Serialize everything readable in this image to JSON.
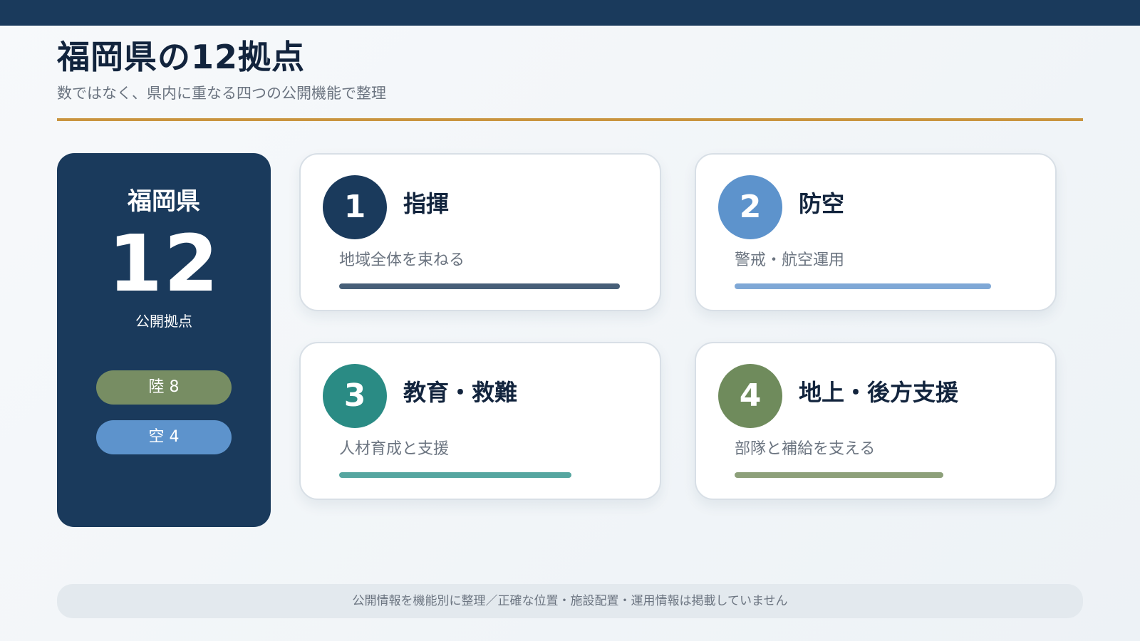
{
  "header": {
    "title": "福岡県の12拠点",
    "subtitle": "数ではなく、県内に重なる四つの公開機能で整理"
  },
  "summary": {
    "prefecture": "福岡県",
    "count": "12",
    "count_label": "公開拠点",
    "land_label": "陸 8",
    "air_label": "空 4"
  },
  "cards": [
    {
      "number": "1",
      "title": "指揮",
      "description": "地域全体を束ねる",
      "bar_fraction": 0.82,
      "circle_color": "#1a3a5c",
      "bar_color": "#475f78"
    },
    {
      "number": "2",
      "title": "防空",
      "description": "警戒・航空運用",
      "bar_fraction": 0.75,
      "circle_color": "#5d93cc",
      "bar_color": "#7fa8d6"
    },
    {
      "number": "3",
      "title": "教育・救難",
      "description": "人材育成と支援",
      "bar_fraction": 0.68,
      "circle_color": "#2a8b84",
      "bar_color": "#56a6a0"
    },
    {
      "number": "4",
      "title": "地上・後方支援",
      "description": "部隊と補給を支える",
      "bar_fraction": 0.61,
      "circle_color": "#6f8b5c",
      "bar_color": "#8da07a"
    }
  ],
  "footer": {
    "note": "公開情報を機能別に整理／正確な位置・施設配置・運用情報は掲載していません"
  },
  "colors": {
    "navy": "#1a3a5c",
    "gold": "#c9943f",
    "land_green": "#778d63",
    "air_blue": "#5d93cc"
  }
}
